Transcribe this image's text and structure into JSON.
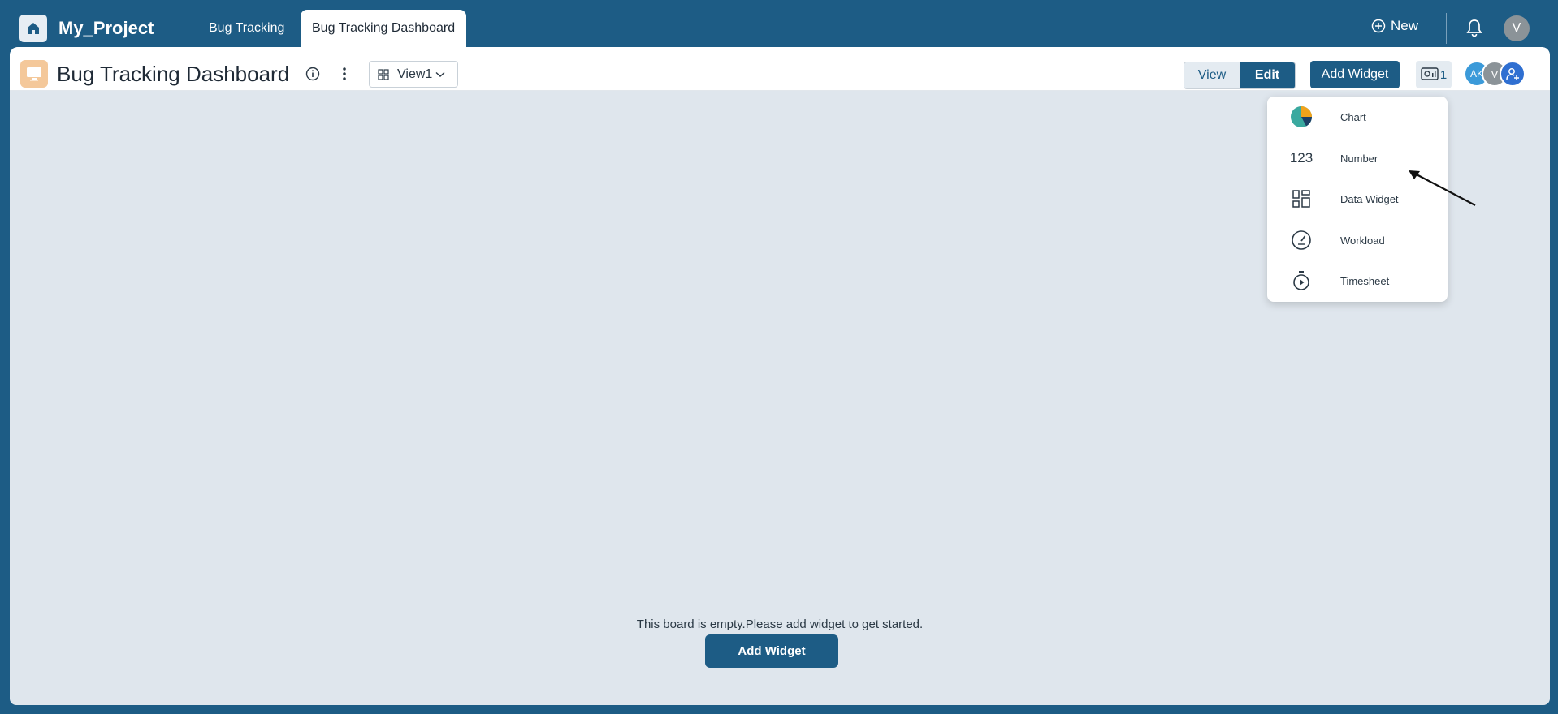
{
  "app": {
    "project_name": "My_Project",
    "tabs": [
      {
        "label": "Bug Tracking"
      },
      {
        "label": "Bug Tracking Dashboard",
        "active": true
      }
    ],
    "new_label": "New",
    "user_initial": "V"
  },
  "board": {
    "title": "Bug Tracking Dashboard",
    "view_selector": "View1",
    "mode_toggle": {
      "view": "View",
      "edit": "Edit",
      "active": "Edit"
    },
    "add_widget_label": "Add Widget",
    "presence_count": "1",
    "members": [
      "AK",
      "V"
    ]
  },
  "widget_menu": {
    "items": [
      {
        "label": "Chart",
        "icon": "pie-chart-icon"
      },
      {
        "label": "Number",
        "icon": "number-icon",
        "glyph": "123"
      },
      {
        "label": "Data Widget",
        "icon": "grid-widget-icon"
      },
      {
        "label": "Workload",
        "icon": "gauge-icon"
      },
      {
        "label": "Timesheet",
        "icon": "stopwatch-icon"
      }
    ]
  },
  "empty_state": {
    "message": "This board is empty.Please add widget to get started.",
    "button_label": "Add Widget"
  },
  "colors": {
    "brand": "#1d5c85",
    "canvas": "#dfe6ed",
    "board_icon": "#f4c89a"
  }
}
